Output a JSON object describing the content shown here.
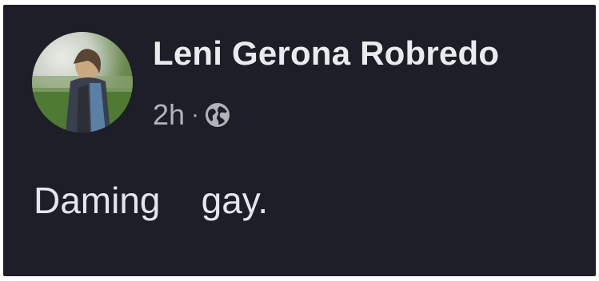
{
  "post": {
    "author": "Leni Gerona Robredo",
    "time": "2h",
    "separator": "·",
    "privacy_icon": "globe-icon",
    "text": "Daming    gay."
  },
  "colors": {
    "background": "#1e1e28",
    "name": "#e9ebee",
    "meta": "#b0b3b8",
    "body_text": "#e4e6eb"
  }
}
